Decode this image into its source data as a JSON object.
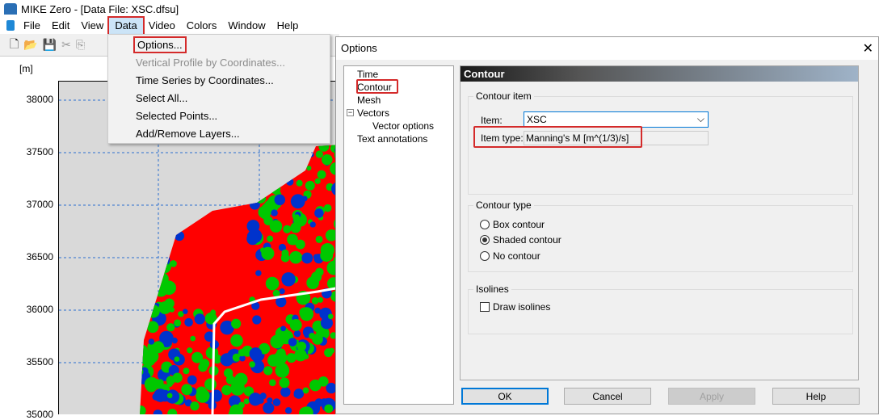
{
  "app": {
    "title": "MIKE Zero - [Data File: XSC.dfsu]"
  },
  "menu": [
    "File",
    "Edit",
    "View",
    "Data",
    "Video",
    "Colors",
    "Window",
    "Help"
  ],
  "data_menu": [
    {
      "label": "Options...",
      "enabled": true,
      "highlighted": true
    },
    {
      "label": "Vertical Profile by Coordinates...",
      "enabled": false
    },
    {
      "label": "Time Series by Coordinates...",
      "enabled": true
    },
    {
      "label": "Select All...",
      "enabled": true
    },
    {
      "label": "Selected Points...",
      "enabled": true
    },
    {
      "label": "Add/Remove Layers...",
      "enabled": true
    }
  ],
  "map": {
    "unit": "[m]",
    "y_ticks": [
      "38000",
      "37500",
      "37000",
      "36500",
      "36000",
      "35500",
      "35000"
    ],
    "colors": {
      "background": "#d9d9d9",
      "red": "#ff0000",
      "green": "#00c800",
      "blue": "#0033cc"
    }
  },
  "dialog": {
    "title": "Options",
    "tree": [
      "Time",
      "Contour",
      "Mesh",
      "Vectors",
      "Vector options",
      "Text annotations"
    ],
    "panel_title": "Contour",
    "contour_item": {
      "legend": "Contour item",
      "item_label": "Item:",
      "item_value": "XSC",
      "type_label": "Item type:",
      "type_value": "Manning's M  [m^(1/3)/s]"
    },
    "contour_type": {
      "legend": "Contour type",
      "options": [
        "Box contour",
        "Shaded contour",
        "No contour"
      ],
      "selected": "Shaded contour"
    },
    "isolines": {
      "legend": "Isolines",
      "draw_label": "Draw isolines",
      "checked": false
    },
    "buttons": {
      "ok": "OK",
      "cancel": "Cancel",
      "apply": "Apply",
      "help": "Help"
    }
  }
}
